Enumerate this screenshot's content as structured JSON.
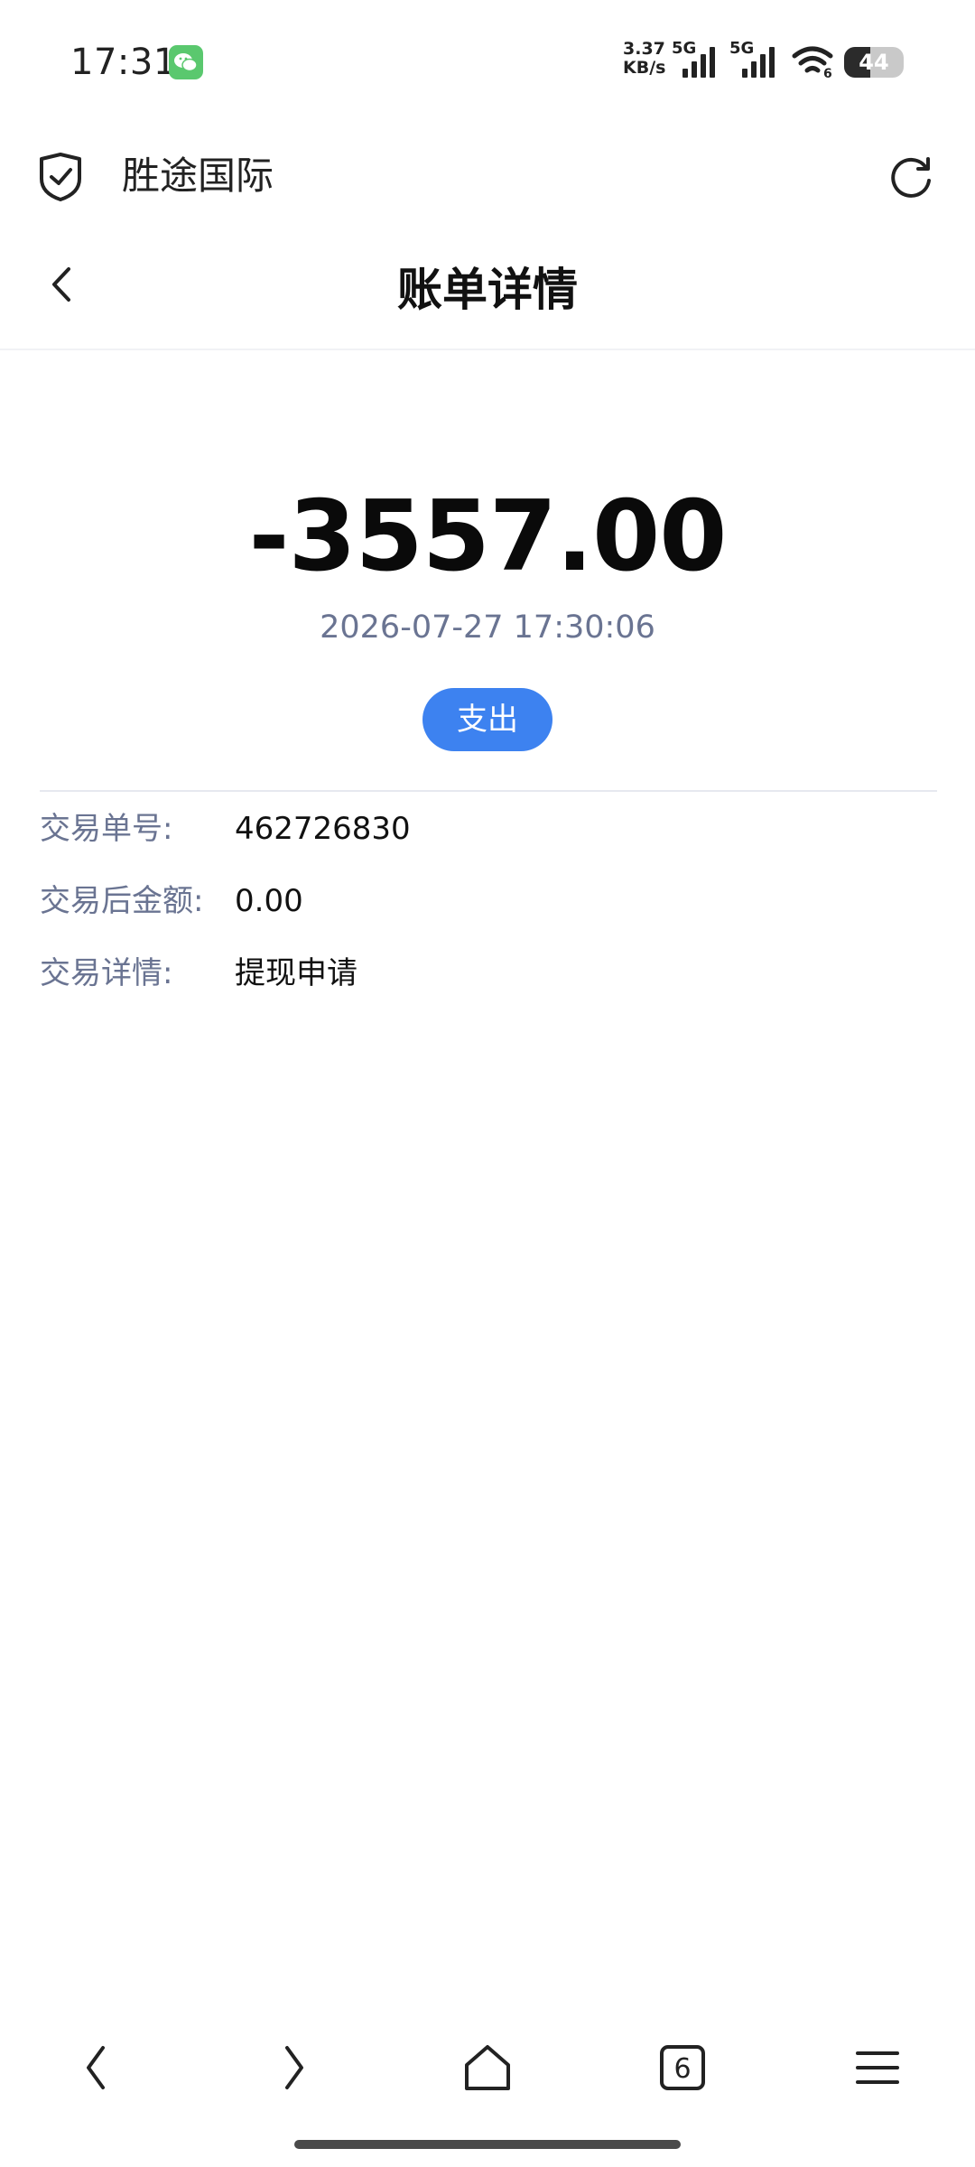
{
  "status_bar": {
    "time": "17:31",
    "network_speed_value": "3.37",
    "network_speed_unit": "KB/s",
    "network_gen_1": "5G",
    "network_gen_2": "5G",
    "wifi_badge": "6",
    "battery_level": "44"
  },
  "browser": {
    "site_title": "胜途国际",
    "tab_count": "6"
  },
  "header": {
    "title": "账单详情"
  },
  "bill": {
    "amount": "-3557.00",
    "datetime": "2026-07-27 17:30:06",
    "type_badge": "支出",
    "colors": {
      "badge": "#3d82f0",
      "label": "#6a7492"
    }
  },
  "details": [
    {
      "label": "交易单号:",
      "value": "462726830"
    },
    {
      "label": "交易后金额:",
      "value": "0.00"
    },
    {
      "label": "交易详情:",
      "value": "提现申请"
    }
  ],
  "icons": {
    "status": [
      "wechat-icon",
      "signal-icon",
      "wifi-icon",
      "battery-icon"
    ],
    "browser": [
      "shield-check-icon",
      "refresh-icon"
    ],
    "toolbar": [
      "back-arrow-icon",
      "forward-arrow-icon",
      "home-icon",
      "tabs-icon",
      "menu-icon"
    ]
  }
}
